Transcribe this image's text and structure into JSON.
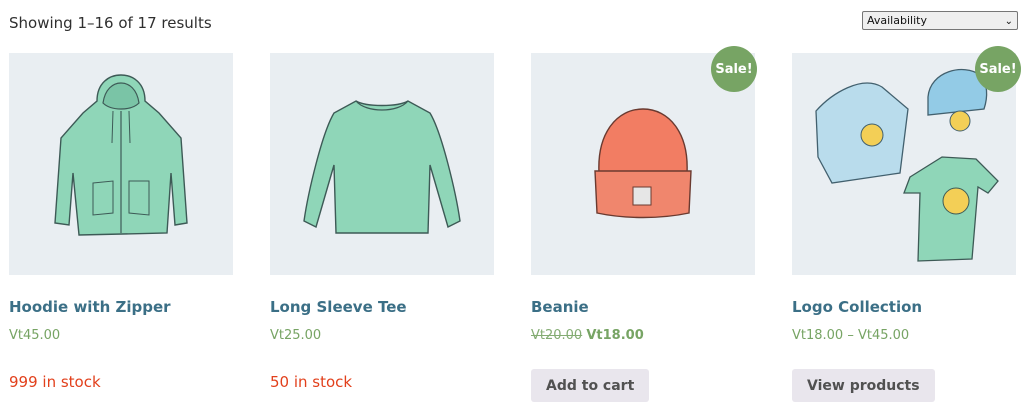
{
  "result_count": "Showing 1–16 of 17 results",
  "sort": {
    "selected": "Availability"
  },
  "colors": {
    "link": "#3b6f86",
    "price": "#77a464",
    "stock": "#e2401c",
    "sale_badge": "#77a464",
    "button_bg": "#e9e6ed",
    "thumb_bg": "#e9eef2"
  },
  "products": [
    {
      "title": "Hoodie with Zipper",
      "price": "Vt45.00",
      "stock": "999 in stock",
      "image_icon": "hoodie-icon"
    },
    {
      "title": "Long Sleeve Tee",
      "price": "Vt25.00",
      "stock": "50 in stock",
      "image_icon": "long-sleeve-tee-icon"
    },
    {
      "title": "Beanie",
      "price_old": "Vt20.00",
      "price_new": "Vt18.00",
      "sale_badge": "Sale!",
      "button": "Add to cart",
      "image_icon": "beanie-icon"
    },
    {
      "title": "Logo Collection",
      "price": "Vt18.00 – Vt45.00",
      "sale_badge": "Sale!",
      "button": "View products",
      "image_icon": "logo-collection-icon"
    }
  ]
}
